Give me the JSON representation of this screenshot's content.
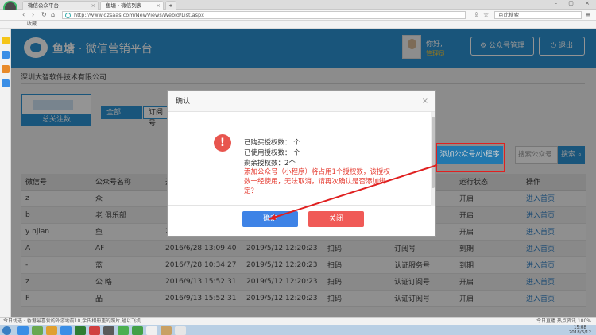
{
  "browser": {
    "tabs": [
      {
        "label": "微信公众平台",
        "active": false
      },
      {
        "label": "鱼塘 · 微信列表",
        "active": true
      }
    ],
    "new_tab": "+",
    "url": "http://www.dzsaas.com/NewViews/Webid/List.aspx",
    "search_placeholder": "点此搜索",
    "favorites_label": "收藏",
    "status_left": "今日优选  ·  香港最喜爱的外游地前10,余氏相册重的照片,碰以飞机",
    "status_right": "今日直播   热点资讯   100%"
  },
  "app": {
    "brand": "鱼塘",
    "brand_sub": "· 微信营销平台",
    "user_greeting": "你好,",
    "user_role": "管理员",
    "btn_account_manage": "公众号管理",
    "btn_logout": "退出",
    "company": "深圳大智软件技术有限公司",
    "stat_label": "总关注数",
    "filter_tabs": [
      "全部",
      "订阅号"
    ],
    "add_button": "添加公众号/小程序",
    "search_placeholder": "搜索公众号",
    "search_button": "搜索"
  },
  "table": {
    "headers": [
      "微信号",
      "公众号名称",
      "开",
      "",
      "",
      "",
      "运行状态",
      "操作"
    ],
    "rows": [
      [
        "z",
        "众",
        "",
        "",
        "",
        "",
        "开启",
        "进入首页"
      ],
      [
        "b",
        "老            俱乐部",
        "",
        "",
        "",
        "",
        "开启",
        "进入首页"
      ],
      [
        "y        njian",
        "鱼",
        "2016/6/16 10:50:52",
        "2019/5/12 12:20:23",
        "扫码",
        "认证服务号",
        "开启",
        "进入首页"
      ],
      [
        "A",
        "AF",
        "2016/6/28 13:09:40",
        "2019/5/12 12:20:23",
        "扫码",
        "订阅号",
        "到期",
        "进入首页"
      ],
      [
        "-",
        "蓝",
        "2016/7/28 10:34:27",
        "2019/5/12 12:20:23",
        "扫码",
        "认证服务号",
        "到期",
        "进入首页"
      ],
      [
        "z",
        "公          略",
        "2016/9/13 15:52:31",
        "2019/5/12 12:20:23",
        "扫码",
        "认证订阅号",
        "开启",
        "进入首页"
      ],
      [
        "F",
        "品",
        "2016/9/13 15:52:31",
        "2019/5/12 12:20:23",
        "扫码",
        "认证订阅号",
        "开启",
        "进入首页"
      ]
    ]
  },
  "dialog": {
    "title": "确认",
    "close_glyph": "×",
    "line1": "已购买授权数：   个",
    "line2": "已使用授权数：   个",
    "line3": "剩余授权数：2个",
    "warning": "添加公众号（小程序）将占用1个授权数，该授权数一经使用，无法取消，请再次确认是否添加绑定？",
    "ok": "确定",
    "cancel": "关闭"
  },
  "clock": {
    "time": "15:08",
    "date": "2018/6/12"
  },
  "colors": {
    "brand_blue": "#2b93d4",
    "ok_blue": "#3e83e6",
    "close_red": "#f05a57",
    "warn_red": "#e53a2f",
    "highlight": "#e02020"
  }
}
